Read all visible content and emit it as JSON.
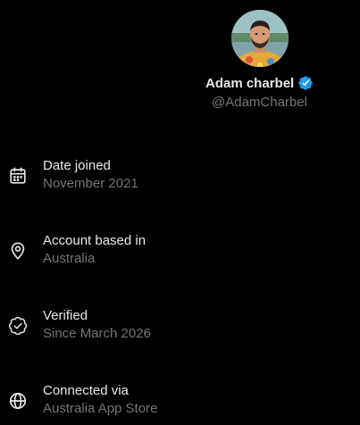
{
  "profile": {
    "name": "Adam charbel",
    "handle": "@AdamCharbel",
    "verified": true,
    "badge_color": "#1d9bf0"
  },
  "info": [
    {
      "icon": "calendar-icon",
      "title": "Date joined",
      "value": "November 2021"
    },
    {
      "icon": "location-pin-icon",
      "title": "Account based in",
      "value": "Australia"
    },
    {
      "icon": "verified-check-icon",
      "title": "Verified",
      "value": "Since March 2026"
    },
    {
      "icon": "globe-icon",
      "title": "Connected via",
      "value": "Australia App Store"
    }
  ],
  "colors": {
    "background": "#000000",
    "primary_text": "#e7e9ea",
    "secondary_text": "#71767b"
  }
}
